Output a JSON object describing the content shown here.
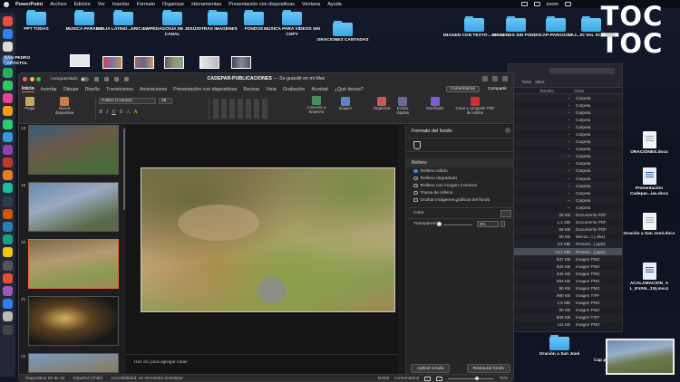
{
  "menubar": {
    "app": "PowerPoint",
    "items": [
      "Archivo",
      "Edición",
      "Ver",
      "Insertar",
      "Formato",
      "Organizar",
      "Herramientas",
      "Presentación con diapositivas",
      "Ventana",
      "Ayuda"
    ],
    "zoom_label": "zoom"
  },
  "desktop": {
    "top_row": [
      {
        "label": "PPT TODAS"
      },
      {
        "label": "MUSICA PARA NT"
      },
      {
        "label": "BIBLIA LATINO...ERICANA"
      },
      {
        "label": "LA PEDAGOGÍA DE JESÚS -CANAL"
      },
      {
        "label": "OTRAS IMAGENES"
      },
      {
        "label": "FONDOS"
      },
      {
        "label": "MUSICA PARA VIDEOS SIN COPY"
      },
      {
        "label": "ORACIONES CANTADAS"
      }
    ],
    "top_right": [
      {
        "label": "IMAGEN CON TEXTO-...TICAL"
      },
      {
        "label": "IMAGENES SIN FONDO"
      },
      {
        "label": "CAP-PARAGON"
      },
      {
        "label": "CAJ...IO VAL 01... 2021"
      }
    ],
    "left_extra": {
      "label": "SAN PEDRO APÓSTOL"
    },
    "right_column": [
      {
        "label": "ORACIONES.docx"
      },
      {
        "label": "Presentación Cadepar...ias.docx"
      },
      {
        "label": "Oración a San José.docx"
      },
      {
        "label": "ACALAMACION_A L_EVAN...15).mscz"
      }
    ],
    "bottom": {
      "label": "Oración a San José"
    },
    "bottom_partial": "Cap pant..."
  },
  "logo_lines": [
    "TOC",
    "TOC"
  ],
  "finder": {
    "filters": [
      "Todos",
      "Sitios"
    ],
    "columns": [
      "Tamaño",
      "Clase"
    ],
    "rows": [
      {
        "size": "--",
        "kind": "Carpeta"
      },
      {
        "size": "--",
        "kind": "Carpeta"
      },
      {
        "size": "--",
        "kind": "Carpeta"
      },
      {
        "size": "--",
        "kind": "Carpeta"
      },
      {
        "size": "--",
        "kind": "Carpeta"
      },
      {
        "size": "--",
        "kind": "Carpeta"
      },
      {
        "size": "--",
        "kind": "Carpeta"
      },
      {
        "size": "--",
        "kind": "Carpeta"
      },
      {
        "size": "--",
        "kind": "Carpeta"
      },
      {
        "size": "--",
        "kind": "Carpeta"
      },
      {
        "size": "--",
        "kind": "Carpeta"
      },
      {
        "size": "--",
        "kind": "Carpeta"
      },
      {
        "size": "--",
        "kind": "Carpeta"
      },
      {
        "size": "--",
        "kind": "Carpeta"
      },
      {
        "size": "--",
        "kind": "Carpeta"
      },
      {
        "size": "--",
        "kind": "Carpeta"
      },
      {
        "size": "28 KB",
        "kind": "Documento PDF"
      },
      {
        "size": "1,1 MB",
        "kind": "Documento PDF"
      },
      {
        "size": "69 KB",
        "kind": "Documento PDF"
      },
      {
        "size": "90 KB",
        "kind": "Micros...t (.xlsx)"
      },
      {
        "size": "3,5 MB",
        "kind": "Present...(.pptx)"
      },
      {
        "size": "13,2 MB",
        "kind": "Present...(.pptx)"
      },
      {
        "size": "837 KB",
        "kind": "Imagen PNG"
      },
      {
        "size": "825 KB",
        "kind": "Imagen PNG"
      },
      {
        "size": "445 KB",
        "kind": "Imagen PNG"
      },
      {
        "size": "893 KB",
        "kind": "Imagen PNG"
      },
      {
        "size": "90 KB",
        "kind": "Imagen PNG"
      },
      {
        "size": "990 KB",
        "kind": "Imagen TIFF"
      },
      {
        "size": "1,5 MB",
        "kind": "Imagen PNG"
      },
      {
        "size": "90 KB",
        "kind": "Imagen PNG"
      },
      {
        "size": "808 KB",
        "kind": "Imagen TIFF"
      },
      {
        "size": "111 KB",
        "kind": "Imagen PNG"
      }
    ],
    "selected_index": 21
  },
  "ppt": {
    "autosave": "Autoguardado",
    "title_doc": "CADEPAR-PUBLICACIONES",
    "title_status": "— Se guardó en mi Mac",
    "tabs": [
      "Inicio",
      "Insertar",
      "Dibujar",
      "Diseño",
      "Transiciones",
      "Animaciones",
      "Presentación con diapositivas",
      "Revisar",
      "Vista",
      "Grabación",
      "Acrobat",
      "¿Qué desea?"
    ],
    "active_tab": 0,
    "comments_btn": "Comentarios",
    "share_btn": "Compartir",
    "ribbon": {
      "paste": "Pegar",
      "new_slide": "Nueva diapositiva",
      "font": "Calibri (Cuerpo)",
      "size": "28",
      "convert": "Convertir a SmartArt",
      "image": "Imagen",
      "arrange": "Organizar",
      "quick_styles": "Estilos rápidos",
      "designer": "Diseñador",
      "create_pdf": "Crear y compartir PDF de Adobe"
    },
    "slide_numbers": [
      "18",
      "19",
      "20",
      "21",
      "22"
    ],
    "selected_slide": "20",
    "notes_placeholder": "Haz clic para agregar notas",
    "pane": {
      "title": "Formato del fondo",
      "section": "Relleno",
      "options": [
        "Relleno sólido",
        "Relleno degradado",
        "Relleno con imagen o textura",
        "Trama de relleno"
      ],
      "selected_option": 0,
      "hide_graphics": "Ocultar imágenes gráficas del fondo",
      "color_label": "Color",
      "transparency_label": "Transparencia",
      "transparency_value": "0%",
      "apply_all": "Aplicar a todo",
      "reset": "Restaurar fondo"
    },
    "status": {
      "slide_of": "Diapositiva 20 de 24",
      "language": "Español (Chile)",
      "accessibility": "Accesibilidad: es necesario investigar",
      "notes": "Notas",
      "comments": "Comentarios",
      "zoom": "76%"
    }
  },
  "colors": {
    "folder": "#4fb4ef",
    "accent": "#e86a3a",
    "radio_on": "#3b82f6"
  }
}
